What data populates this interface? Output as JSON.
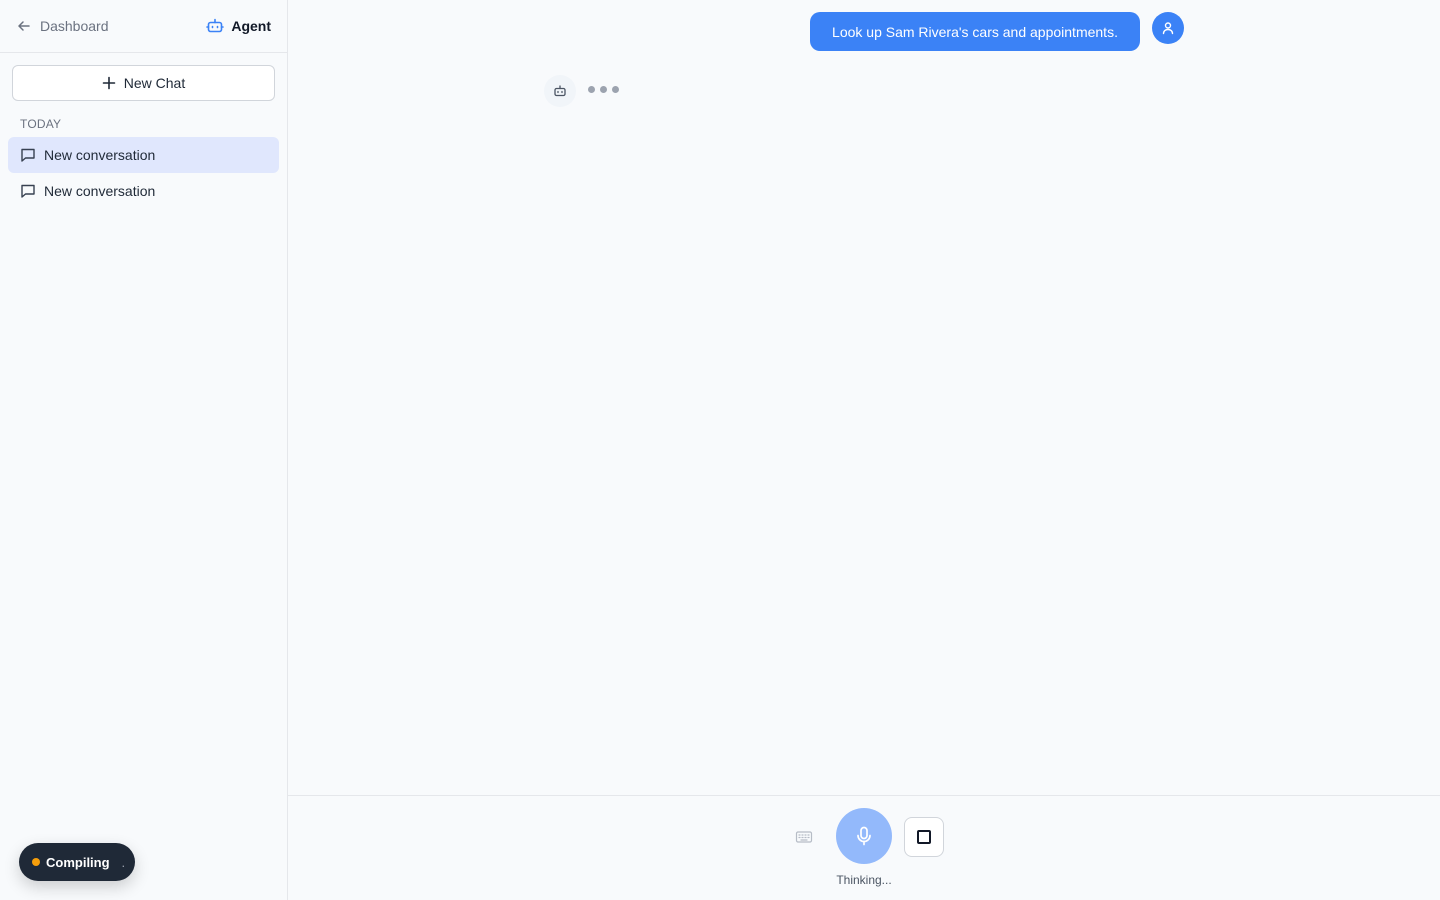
{
  "sidebar": {
    "back_label": "Dashboard",
    "mode_label": "Agent",
    "new_chat_label": "New Chat",
    "section_label": "TODAY",
    "conversations": [
      {
        "label": "New conversation",
        "active": true
      },
      {
        "label": "New conversation",
        "active": false
      }
    ],
    "build_status": "Compiling",
    "build_status_suffix": ".",
    "build_status_color": "#f59e0b"
  },
  "chat": {
    "messages": [
      {
        "role": "user",
        "text": "Look up Sam Rivera's cars and appointments."
      }
    ],
    "assistant_state": "typing"
  },
  "composer": {
    "status_text": "Thinking..."
  },
  "colors": {
    "accent": "#3b82f6",
    "accent_light": "#93b9fb",
    "active_item_bg": "#e0e7fd"
  },
  "icons": {
    "back": "arrow-left-icon",
    "agent": "robot-icon",
    "new_chat": "plus-icon",
    "conversation": "message-square-icon",
    "user": "user-icon",
    "assistant": "robot-icon",
    "keyboard": "keyboard-icon",
    "mic": "microphone-icon",
    "stop": "stop-icon"
  }
}
